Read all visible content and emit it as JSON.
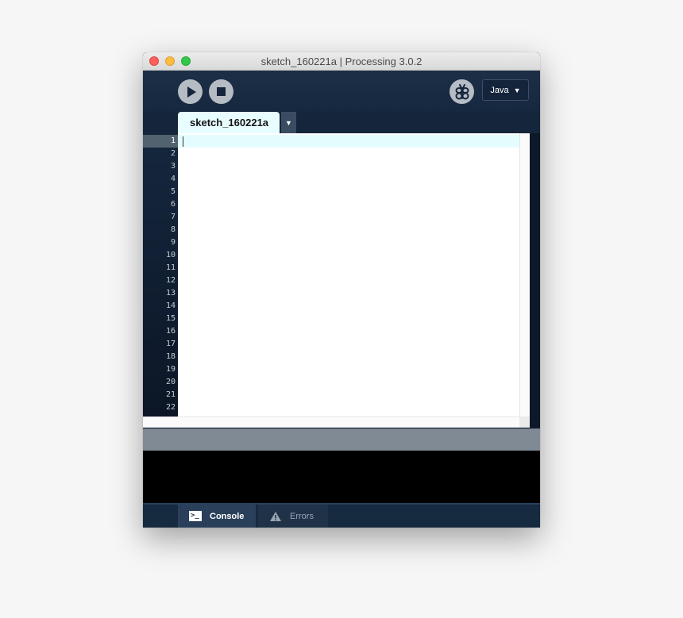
{
  "window": {
    "title": "sketch_160221a | Processing 3.0.2"
  },
  "toolbar": {
    "run_icon": "play-icon",
    "stop_icon": "stop-icon",
    "debug_icon": "butterfly-debug-icon",
    "mode": "Java",
    "mode_arrow": "▼"
  },
  "editor": {
    "tab_label": "sketch_160221a",
    "tab_menu_arrow": "▼",
    "current_line": 1,
    "line_numbers": [
      "1",
      "2",
      "3",
      "4",
      "5",
      "6",
      "7",
      "8",
      "9",
      "10",
      "11",
      "12",
      "13",
      "14",
      "15",
      "16",
      "17",
      "18",
      "19",
      "20",
      "21",
      "22"
    ]
  },
  "footer": {
    "console_label": "Console",
    "errors_label": "Errors",
    "console_icon": "terminal-icon",
    "errors_icon": "warning-icon"
  }
}
